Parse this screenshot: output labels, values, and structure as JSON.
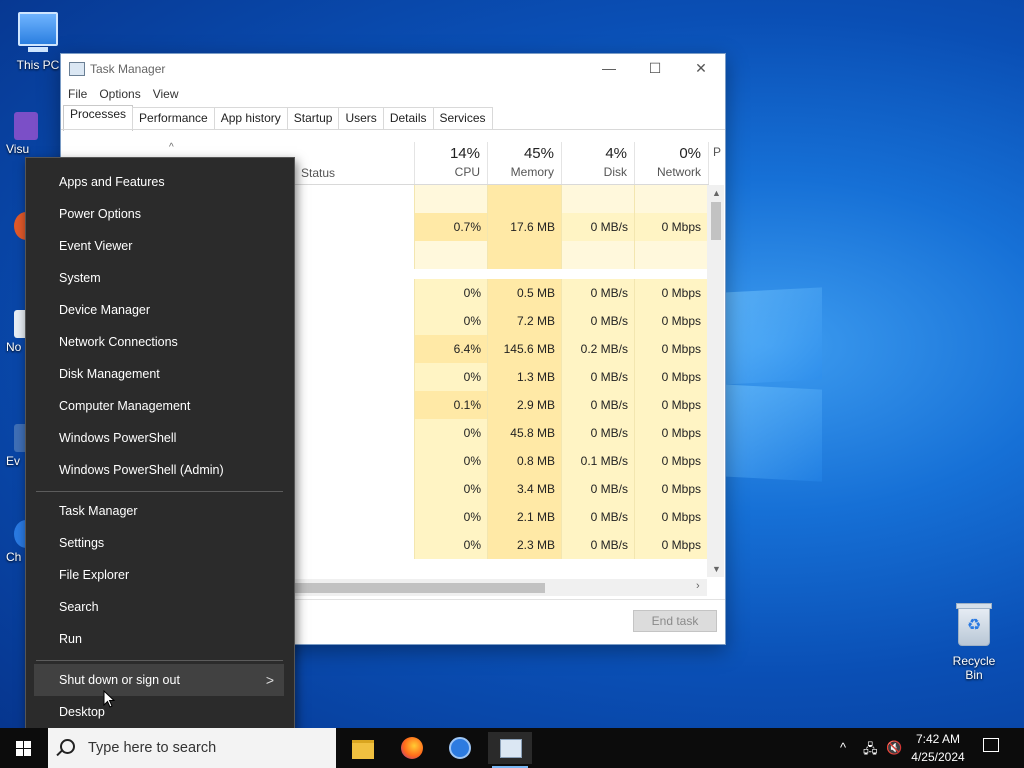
{
  "desktop": {
    "this_pc_label": "This PC",
    "recycle_bin_label": "Recycle Bin",
    "side_labels": [
      "Visu",
      "",
      "No",
      "Ev",
      "Ch"
    ]
  },
  "task_manager": {
    "title": "Task Manager",
    "controls": {
      "minimize": "—",
      "maximize": "☐",
      "close": "✕"
    },
    "menu": [
      "File",
      "Options",
      "View"
    ],
    "tabs": [
      "Processes",
      "Performance",
      "App history",
      "Startup",
      "Users",
      "Details",
      "Services"
    ],
    "active_tab": "Processes",
    "status_header": "Status",
    "columns": [
      {
        "pct": "14%",
        "name": "CPU"
      },
      {
        "pct": "45%",
        "name": "Memory"
      },
      {
        "pct": "4%",
        "name": "Disk"
      },
      {
        "pct": "0%",
        "name": "Network"
      },
      {
        "pct": "",
        "name": "P"
      }
    ],
    "rows": [
      [
        "",
        "",
        "",
        ""
      ],
      [
        "0.7%",
        "17.6 MB",
        "0 MB/s",
        "0 Mbps"
      ],
      [
        "",
        "",
        "",
        ""
      ],
      [
        "0%",
        "0.5 MB",
        "0 MB/s",
        "0 Mbps"
      ],
      [
        "0%",
        "7.2 MB",
        "0 MB/s",
        "0 Mbps"
      ],
      [
        "6.4%",
        "145.6 MB",
        "0.2 MB/s",
        "0 Mbps"
      ],
      [
        "0%",
        "1.3 MB",
        "0 MB/s",
        "0 Mbps"
      ],
      [
        "0.1%",
        "2.9 MB",
        "0 MB/s",
        "0 Mbps"
      ],
      [
        "0%",
        "45.8 MB",
        "0 MB/s",
        "0 Mbps"
      ],
      [
        "0%",
        "0.8 MB",
        "0.1 MB/s",
        "0 Mbps"
      ],
      [
        "0%",
        "3.4 MB",
        "0 MB/s",
        "0 Mbps"
      ],
      [
        "0%",
        "2.1 MB",
        "0 MB/s",
        "0 Mbps"
      ],
      [
        "0%",
        "2.3 MB",
        "0 MB/s",
        "0 Mbps"
      ]
    ],
    "end_task_label": "End task",
    "colors": {
      "cell_light": "#fff4c4",
      "cell_medium": "#ffe9a6",
      "cell_empty": "#fff8dc"
    }
  },
  "context_menu": {
    "group1": [
      "Apps and Features",
      "Power Options",
      "Event Viewer",
      "System",
      "Device Manager",
      "Network Connections",
      "Disk Management",
      "Computer Management",
      "Windows PowerShell",
      "Windows PowerShell (Admin)"
    ],
    "group2": [
      "Task Manager",
      "Settings",
      "File Explorer",
      "Search",
      "Run"
    ],
    "group3": [
      "Shut down or sign out",
      "Desktop"
    ],
    "submenu_chevron": ">"
  },
  "taskbar": {
    "search_placeholder": "Type here to search",
    "apps": [
      "file-explorer-icon",
      "firefox-icon",
      "chrome-icon",
      "task-manager-icon"
    ],
    "time": "7:42 AM",
    "date": "4/25/2024",
    "tray_up": "^"
  }
}
